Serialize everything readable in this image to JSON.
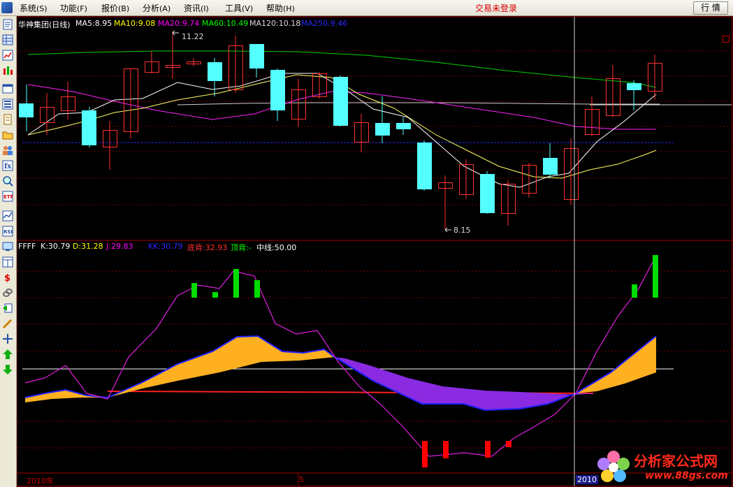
{
  "menu": {
    "items": [
      {
        "label": "系统",
        "key": "(S)"
      },
      {
        "label": "功能",
        "key": "(F)"
      },
      {
        "label": "报价",
        "key": "(B)"
      },
      {
        "label": "分析",
        "key": "(A)"
      },
      {
        "label": "资讯",
        "key": "(I)"
      },
      {
        "label": "工具",
        "key": "(V)"
      },
      {
        "label": "帮助",
        "key": "(H)"
      }
    ],
    "status": "交易未登录",
    "quote_button": "行 情"
  },
  "price_panel": {
    "stock": "华神集团(日线)",
    "ma5": "MA5:8.95",
    "ma10": "MA10:9.08",
    "ma20": "MA20:9.74",
    "ma60": "MA60:10.49",
    "ma120": "MA120:10.18",
    "ma250": "MA250:9.46",
    "high_label": "11.22",
    "low_label": "8.15",
    "colors": {
      "up": "#ff3232",
      "down": "#54ffff",
      "ma5": "#ffffff",
      "ma10": "#ffff00",
      "ma20": "#ff00ff",
      "ma60": "#00ff00",
      "ma120": "#dcdcdc",
      "ma250": "#0000ff"
    }
  },
  "indicator_panel": {
    "name": "FFFF",
    "k": "K:30.79",
    "d": "D:31.28",
    "j": "J:29.83",
    "kk": "KK:30.79",
    "dibei": "底背:32.93",
    "dingbei": "顶背:-",
    "zhongxian": "中线:50.00",
    "colors": {
      "j_line": "#ff00ff",
      "fill_up": "#ffb020",
      "fill_down": "#8a2be2",
      "kk_line": "#1e1eff",
      "bar_green": "#00ff00",
      "bar_red": "#ff0000"
    }
  },
  "x_axis": {
    "start_label": "2010年",
    "mid_label": "5",
    "cursor_label": "2010"
  },
  "watermark": {
    "text1": "分析家公式网",
    "text2": "www.88gs.com"
  },
  "toolbar_icons": [
    "report-icon",
    "grid-icon",
    "line-chart-icon",
    "bar-chart-icon",
    "window-icon",
    "list-icon",
    "document-icon",
    "folder-icon",
    "people-icon",
    "formula-icon",
    "search-icon",
    "etf-icon",
    "trend-icon",
    "rsi-icon",
    "monitor-icon",
    "table-icon",
    "money-icon",
    "link-icon",
    "export-icon",
    "pen-icon",
    "move-icon",
    "up-arrow-icon",
    "down-arrow-icon"
  ]
}
